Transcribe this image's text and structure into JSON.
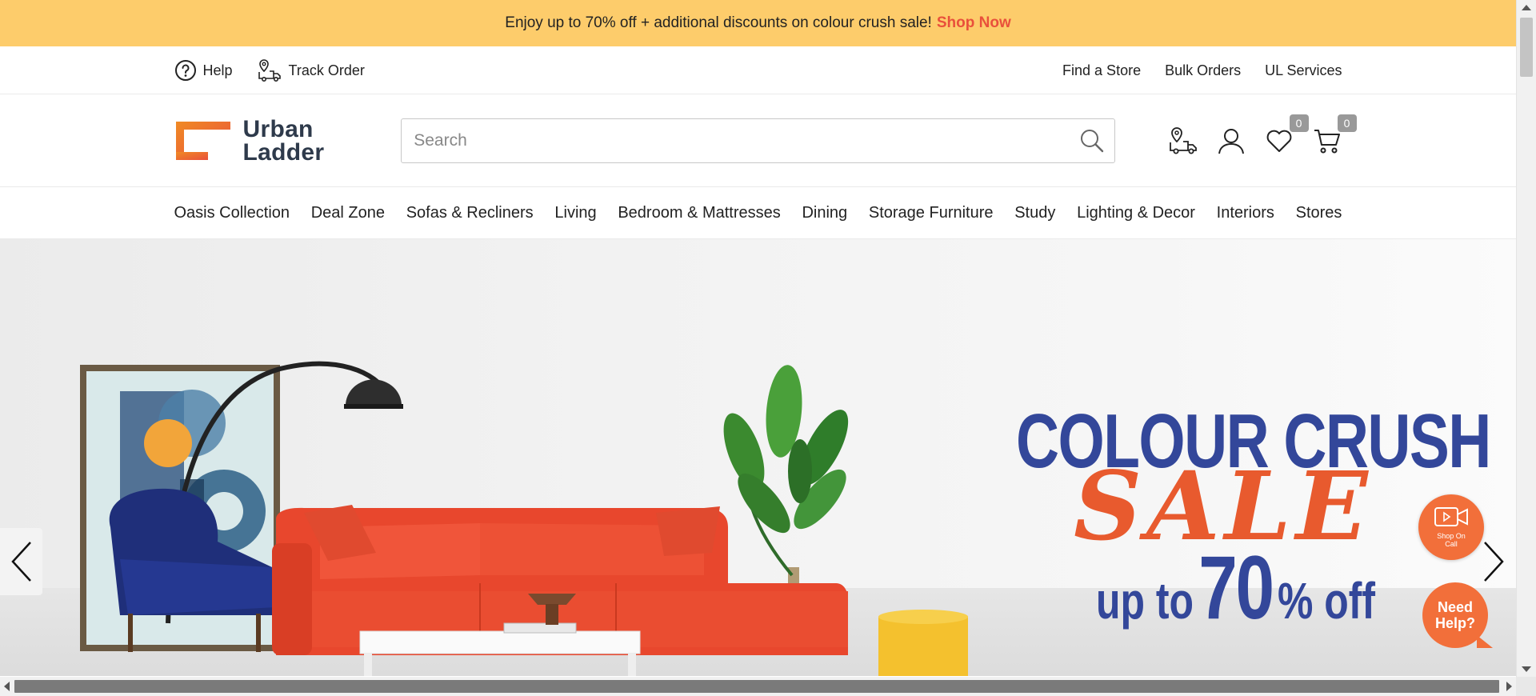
{
  "promo": {
    "text": "Enjoy up to 70% off + additional discounts on colour crush sale!",
    "link": "Shop Now"
  },
  "utility": {
    "help": "Help",
    "track_order": "Track Order",
    "find_store": "Find a Store",
    "bulk_orders": "Bulk Orders",
    "ul_services": "UL Services"
  },
  "header": {
    "logo_line1": "Urban",
    "logo_line2": "Ladder",
    "search_placeholder": "Search",
    "wishlist_count": "0",
    "cart_count": "0"
  },
  "nav": {
    "items": [
      "Oasis Collection",
      "Deal Zone",
      "Sofas & Recliners",
      "Living",
      "Bedroom & Mattresses",
      "Dining",
      "Storage Furniture",
      "Study",
      "Lighting & Decor",
      "Interiors",
      "Stores"
    ]
  },
  "hero": {
    "line1": "COLOUR CRUSH",
    "line2": "SALE",
    "line3_a": "up to",
    "line3_b": "70",
    "line3_c": "% off"
  },
  "floating": {
    "shop_on_call": "Shop On Call",
    "need_help": "Need Help?"
  },
  "colors": {
    "promo_bg": "#fdcc6b",
    "accent": "#e9503b",
    "brand_navy": "#2e3a4b",
    "hero_blue": "#33479a",
    "hero_orange": "#e85a2e"
  }
}
